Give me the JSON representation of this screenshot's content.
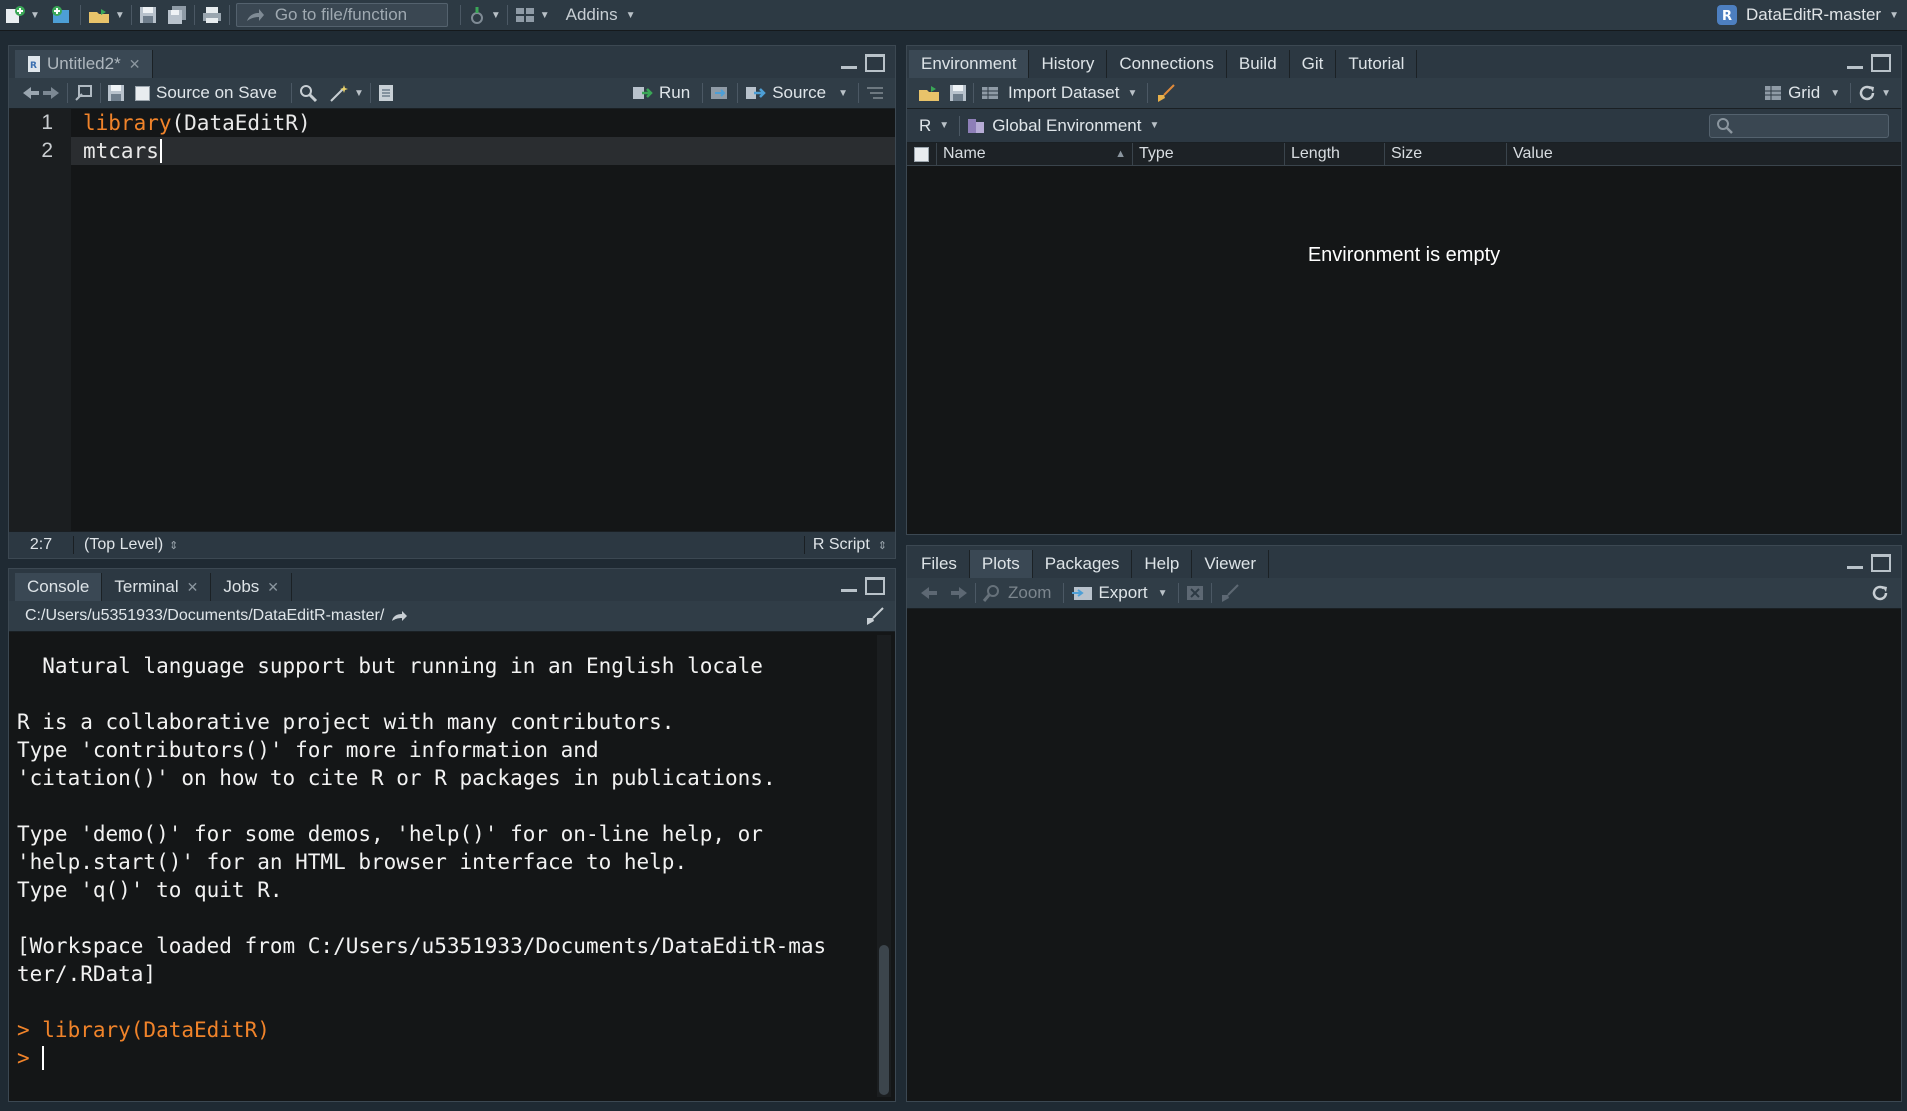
{
  "toolbar": {
    "goto_placeholder": "Go to file/function",
    "addins_label": "Addins",
    "project_name": "DataEditR-master"
  },
  "source_pane": {
    "tab_title": "Untitled2*",
    "source_on_save_label": "Source on Save",
    "run_label": "Run",
    "source_label": "Source",
    "line_numbers": [
      "1",
      "2"
    ],
    "lines": [
      {
        "fn": "library",
        "rest": "(DataEditR)"
      },
      {
        "fn": "",
        "rest": "mtcars"
      }
    ],
    "status_position": "2:7",
    "status_scope": "(Top Level)",
    "status_filetype": "R Script"
  },
  "console_pane": {
    "tabs": [
      "Console",
      "Terminal",
      "Jobs"
    ],
    "path": "C:/Users/u5351933/Documents/DataEditR-master/",
    "lines": [
      "  Natural language support but running in an English locale",
      "",
      "R is a collaborative project with many contributors.",
      "Type 'contributors()' for more information and",
      "'citation()' on how to cite R or R packages in publications.",
      "",
      "Type 'demo()' for some demos, 'help()' for on-line help, or",
      "'help.start()' for an HTML browser interface to help.",
      "Type 'q()' to quit R.",
      "",
      "[Workspace loaded from C:/Users/u5351933/Documents/DataEditR-mas",
      "ter/.RData]",
      ""
    ],
    "command_line": "> library(DataEditR)",
    "prompt": "> "
  },
  "env_pane": {
    "tabs": [
      "Environment",
      "History",
      "Connections",
      "Build",
      "Git",
      "Tutorial"
    ],
    "import_label": "Import Dataset",
    "grid_label": "Grid",
    "lang_label": "R",
    "scope_label": "Global Environment",
    "columns": [
      "Name",
      "Type",
      "Length",
      "Size",
      "Value"
    ],
    "empty_message": "Environment is empty"
  },
  "files_pane": {
    "tabs": [
      "Files",
      "Plots",
      "Packages",
      "Help",
      "Viewer"
    ],
    "zoom_label": "Zoom",
    "export_label": "Export"
  }
}
